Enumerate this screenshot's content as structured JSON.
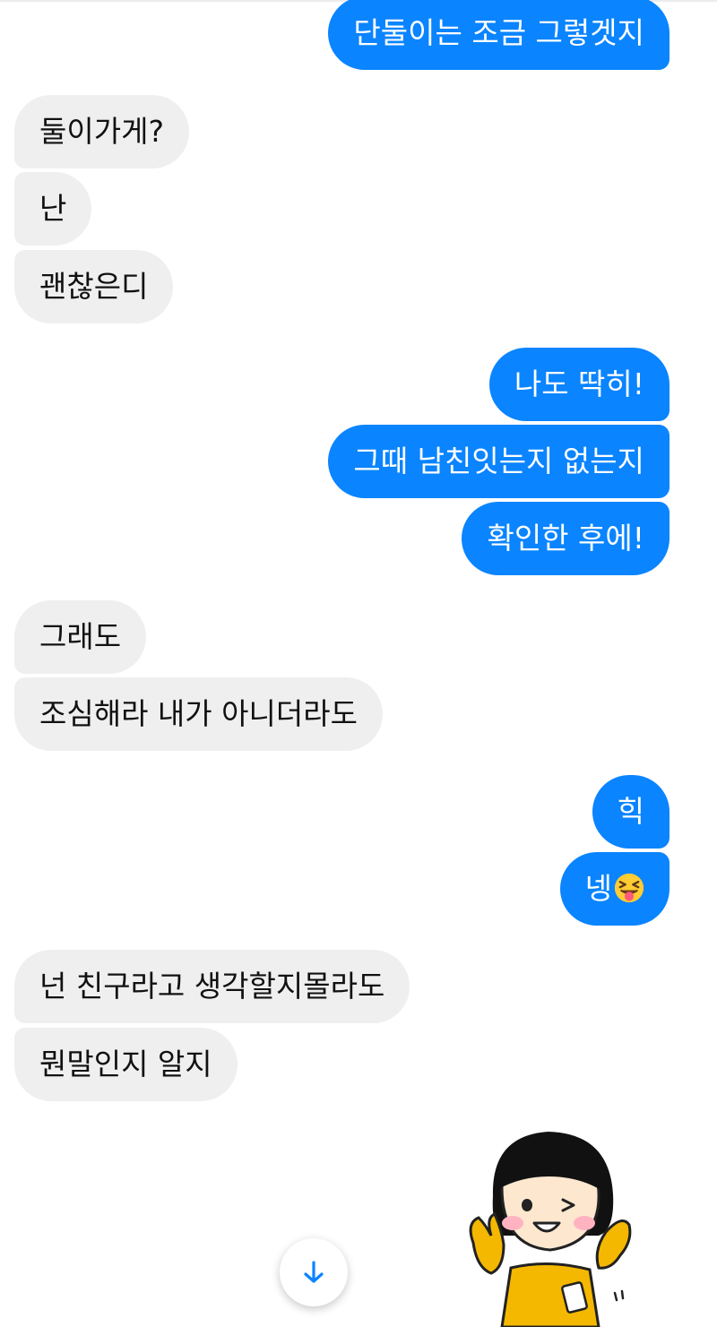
{
  "messages": [
    {
      "side": "out",
      "text": "단둘이는 조금 그렇겟지"
    },
    {
      "side": "in",
      "text": "둘이가게?"
    },
    {
      "side": "in",
      "text": "난"
    },
    {
      "side": "in",
      "text": "괜찮은디"
    },
    {
      "side": "out",
      "text": "나도 딱히!"
    },
    {
      "side": "out",
      "text": "그때 남친잇는지 없는지"
    },
    {
      "side": "out",
      "text": "확인한 후에!"
    },
    {
      "side": "in",
      "text": "그래도"
    },
    {
      "side": "in",
      "text": "조심해라 내가 아니더라도"
    },
    {
      "side": "out",
      "text": "힉"
    },
    {
      "side": "out",
      "text": "넹",
      "emoji": "squinting-tongue-emoji"
    },
    {
      "side": "in",
      "text": "넌 친구라고 생각할지몰라도"
    },
    {
      "side": "in",
      "text": "뭔말인지 알지"
    }
  ],
  "sticker": {
    "name": "girl-sticker"
  },
  "scroll_button": {
    "icon": "arrow-down-icon"
  },
  "colors": {
    "outgoing_bubble": "#0a84ff",
    "incoming_bubble": "#efefef",
    "scroll_arrow": "#0a84ff"
  }
}
